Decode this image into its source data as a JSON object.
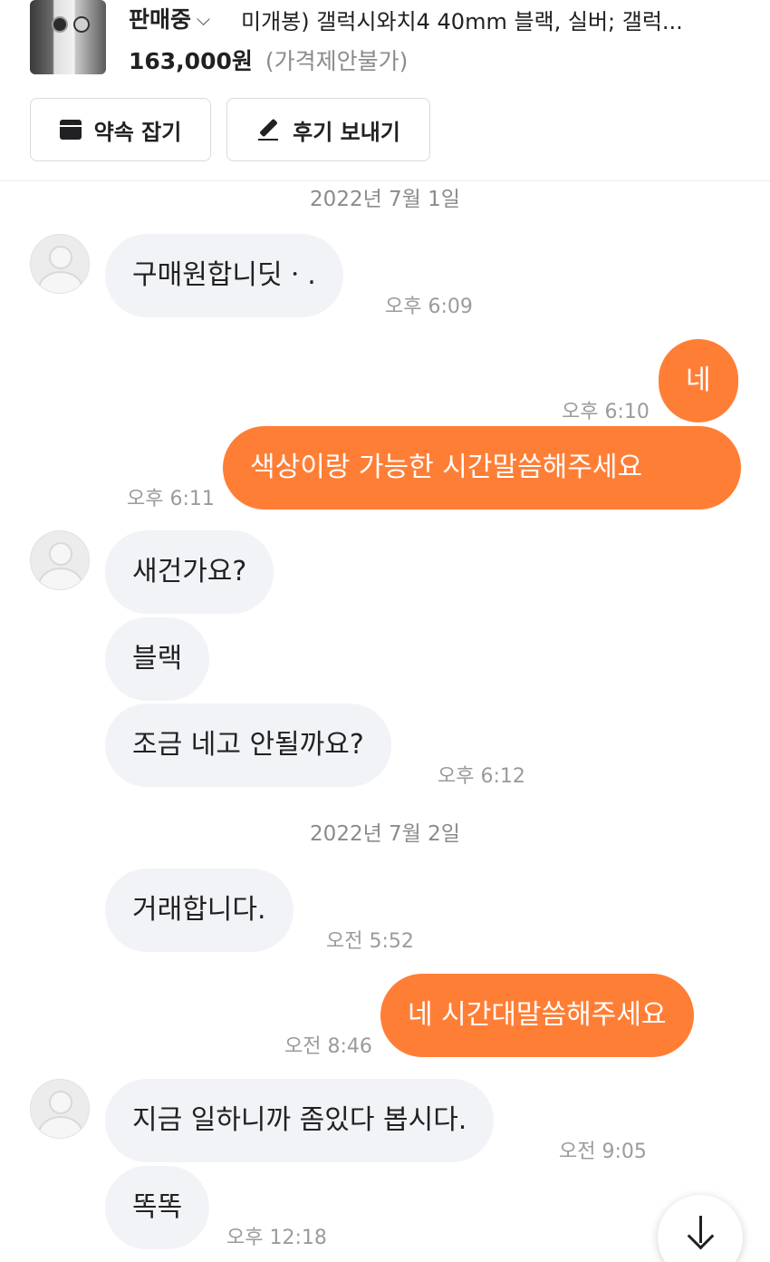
{
  "product": {
    "status": "판매중",
    "title": "미개봉) 갤럭시와치4 40mm 블랙, 실버; 갤럭...",
    "price": "163,000원",
    "price_note": "(가격제안불가)"
  },
  "actions": {
    "appointment_label": "약속 잡기",
    "review_label": "후기 보내기"
  },
  "chat": {
    "date1": "2022년 7월 1일",
    "date2": "2022년 7월 2일",
    "m1": {
      "text": "구매원합니딧ㆍ.",
      "time": "오후 6:09"
    },
    "m2": {
      "text": "네",
      "time": "오후 6:10"
    },
    "m3": {
      "text": "색상이랑 가능한 시간말씀해주세요",
      "time": "오후 6:11"
    },
    "m4": {
      "text": "새건가요?"
    },
    "m5": {
      "text": "블랙"
    },
    "m6": {
      "text": "조금 네고 안될까요?",
      "time": "오후 6:12"
    },
    "m7": {
      "text": "거래합니다.",
      "time": "오전 5:52"
    },
    "m8": {
      "text": "네 시간대말씀해주세요",
      "time": "오전 8:46"
    },
    "m9": {
      "text": "지금 일하니까 좀있다 봅시다.",
      "time": "오전 9:05"
    },
    "m10": {
      "text": "똑똑",
      "time": "오후 12:18"
    }
  },
  "colors": {
    "accent": "#ff7e36",
    "incoming_bubble": "#f2f3f6"
  },
  "icons": {
    "calendar": "calendar-icon",
    "pencil": "pencil-icon",
    "scroll_down": "arrow-down-icon",
    "dropdown": "chevron-down-icon"
  }
}
